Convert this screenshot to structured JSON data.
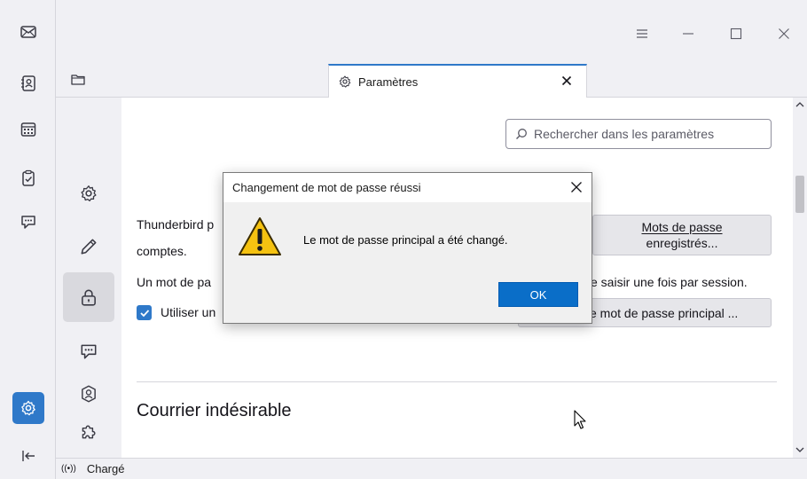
{
  "window": {
    "controls": {
      "menu_icon": "hamburger-icon",
      "minimize_icon": "minimize-icon",
      "maximize_icon": "maximize-icon",
      "close_icon": "close-icon"
    }
  },
  "spaces_toolbar": {
    "items": [
      {
        "name": "mail",
        "icon": "mail-icon"
      },
      {
        "name": "address-book",
        "icon": "address-book-icon"
      },
      {
        "name": "calendar",
        "icon": "calendar-icon"
      },
      {
        "name": "tasks",
        "icon": "tasks-icon"
      },
      {
        "name": "chat",
        "icon": "chat-icon"
      },
      {
        "name": "settings",
        "icon": "gear-icon",
        "active": true
      },
      {
        "name": "collapse",
        "icon": "collapse-icon"
      }
    ]
  },
  "tabs": [
    {
      "label": "Paramètres",
      "icon": "gear-icon",
      "active": true
    }
  ],
  "search": {
    "placeholder": "Rechercher dans les paramètres"
  },
  "categories": [
    {
      "name": "general",
      "icon": "gear-icon"
    },
    {
      "name": "composition",
      "icon": "pencil-icon"
    },
    {
      "name": "privacy-security",
      "icon": "lock-icon",
      "active": true
    },
    {
      "name": "chat",
      "icon": "chat-icon"
    },
    {
      "name": "account",
      "icon": "account-icon"
    },
    {
      "name": "addons",
      "icon": "puzzle-icon"
    }
  ],
  "content": {
    "para1_start": "Thunderbird p",
    "para1_line2": "comptes.",
    "saved_passwords_btn": {
      "line1": "Mots de passe",
      "line2": "enregistrés..."
    },
    "para2_start": "Un mot de pa",
    "para2_end": "e saisir une fois par session.",
    "checkbox_label": "Utiliser un",
    "checkbox_checked": true,
    "change_primary_btn": "e mot de passe principal ...",
    "section_title": "Courrier indésirable"
  },
  "statusbar": {
    "text": "Chargé",
    "signal_glyph": "((•))"
  },
  "dialog": {
    "title": "Changement de mot de passe réussi",
    "message": "Le mot de passe principal a été changé.",
    "ok_label": "OK",
    "icon": "warning-icon"
  },
  "colors": {
    "accent": "#2f79c9",
    "ok_button": "#0a6ec8",
    "panel_bg": "#f0f0f4"
  }
}
